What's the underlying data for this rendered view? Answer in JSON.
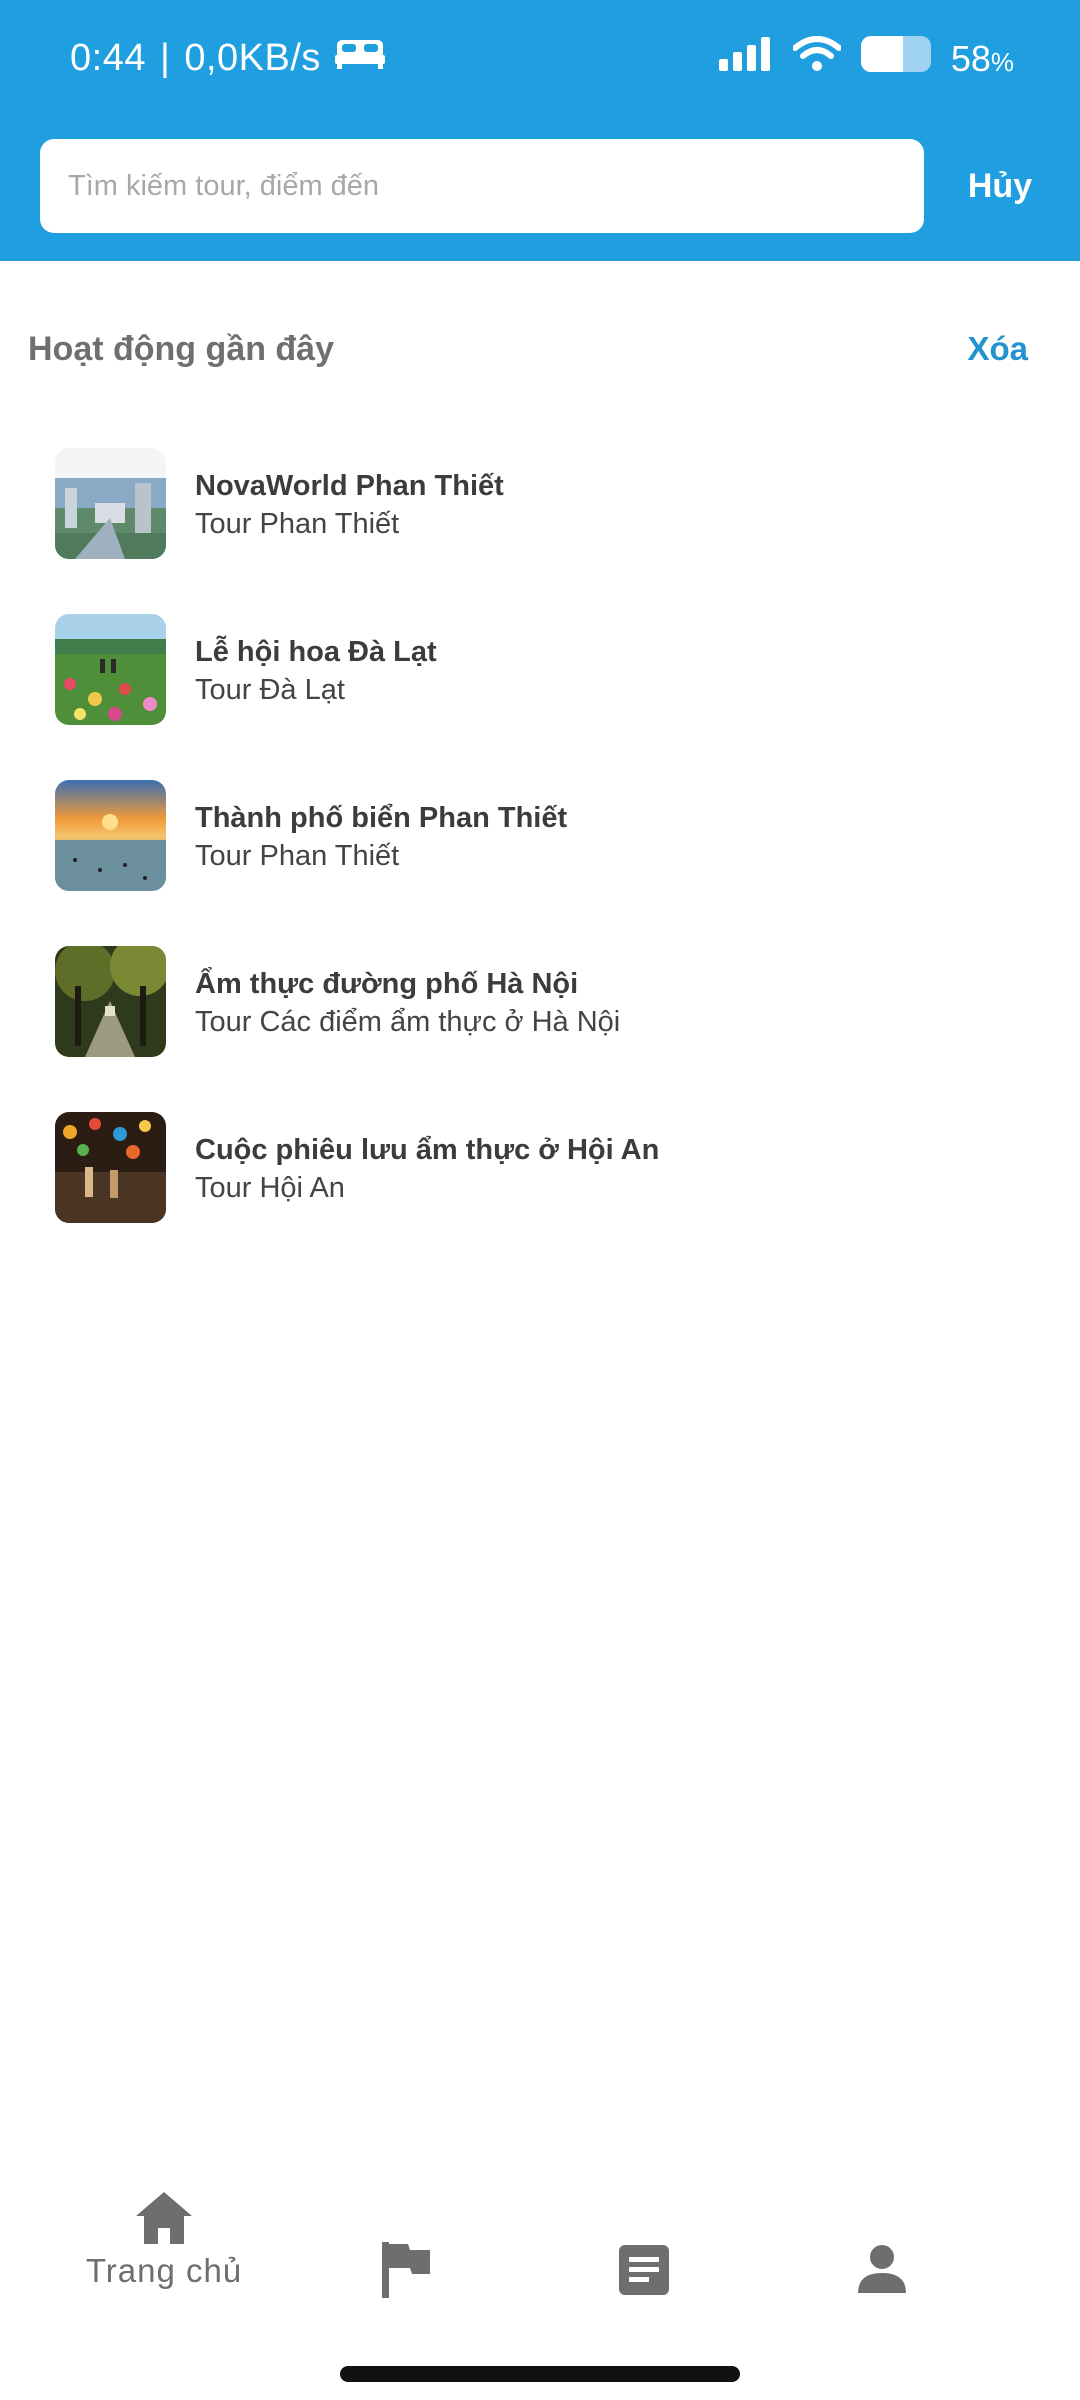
{
  "status_bar": {
    "time": "0:44",
    "separator": "|",
    "net_speed": "0,0KB/s",
    "battery_percent": "58",
    "battery_unit": "%",
    "icons": [
      "bed-icon",
      "signal-icon",
      "wifi-icon",
      "battery-icon"
    ]
  },
  "search": {
    "placeholder": "Tìm kiếm tour, điểm đến",
    "value": "",
    "cancel_label": "Hủy"
  },
  "recent": {
    "title": "Hoạt động gần đây",
    "clear_label": "Xóa",
    "items": [
      {
        "title": "NovaWorld Phan Thiết",
        "subtitle": "Tour Phan Thiết"
      },
      {
        "title": "Lễ hội hoa Đà Lạt",
        "subtitle": "Tour Đà Lạt"
      },
      {
        "title": "Thành phố biển Phan Thiết",
        "subtitle": "Tour Phan Thiết"
      },
      {
        "title": "Ẩm thực đường phố Hà Nội",
        "subtitle": "Tour Các điểm ẩm thực ở Hà Nội"
      },
      {
        "title": "Cuộc phiêu lưu ẩm thực ở Hội An",
        "subtitle": "Tour Hội An"
      }
    ]
  },
  "bottom_nav": {
    "items": [
      {
        "icon": "home-icon",
        "label": "Trang chủ"
      },
      {
        "icon": "flag-icon",
        "label": ""
      },
      {
        "icon": "document-icon",
        "label": ""
      },
      {
        "icon": "person-icon",
        "label": ""
      }
    ]
  },
  "colors": {
    "header_bg": "#1f9ee0",
    "accent": "#2193cf",
    "nav_icon": "#6e6e6e"
  }
}
